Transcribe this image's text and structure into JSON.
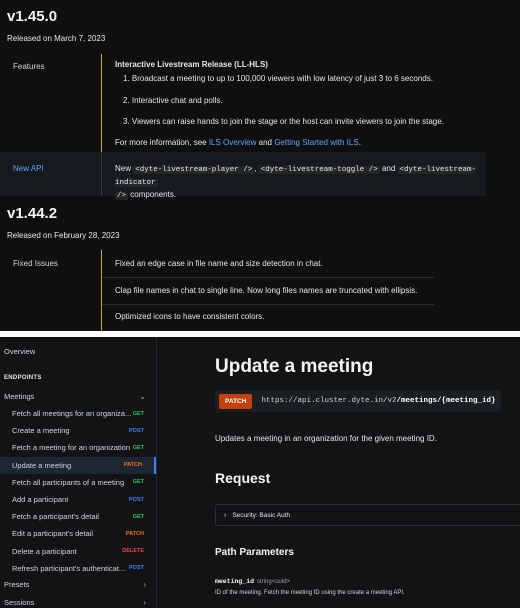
{
  "changelog": {
    "v1": {
      "version": "v1.45.0",
      "released": "Released on March 7, 2023",
      "features_label": "Features",
      "features_title": "Interactive Livestream Release (LL-HLS)",
      "items": [
        "1. Broadcast a meeting to up to 100,000 viewers with low latency of just 3 to 6 seconds.",
        "2. Interactive chat and polls.",
        "3. Viewers can raise hands to join the stage or the host can invite viewers to join the stage."
      ],
      "more_prefix": "For more information, see ",
      "link1": "ILS Overview",
      "and": " and ",
      "link2": "Getting Started with ILS",
      "more_suffix": ".",
      "newapi_label": "New API",
      "newapi_prefix": "New ",
      "code1": "<dyte-livestream-player />",
      "comma": ", ",
      "code2": "<dyte-livestream-toggle />",
      "and2": " and ",
      "code3": "<dyte-livestream-indicator",
      "code3b": "/>",
      "newapi_suffix": " components."
    },
    "v2": {
      "version": "v1.44.2",
      "released": "Released on February 28, 2023",
      "fixed_label": "Fixed Issues",
      "fixes": [
        "Fixed an edge case in file name and size detection in chat.",
        "Clap file names in chat to single line. Now long files names are truncated with ellipsis.",
        "Optimized icons to have consistent colors."
      ]
    }
  },
  "sidebar": {
    "overview": "Overview",
    "endpoints_header": "ENDPOINTS",
    "meetings": "Meetings",
    "items": [
      {
        "label": "Fetch all meetings for an organiza...",
        "method": "GET"
      },
      {
        "label": "Create a meeting",
        "method": "POST"
      },
      {
        "label": "Fetch a meeting for an organization",
        "method": "GET"
      },
      {
        "label": "Update a meeting",
        "method": "PATCH"
      },
      {
        "label": "Fetch all participants of a meeting",
        "method": "GET"
      },
      {
        "label": "Add a participant",
        "method": "POST"
      },
      {
        "label": "Fetch a participant's detail",
        "method": "GET"
      },
      {
        "label": "Edit a participant's detail",
        "method": "PATCH"
      },
      {
        "label": "Delete a participant",
        "method": "DELETE"
      },
      {
        "label": "Refresh participant's authenticat...",
        "method": "POST"
      }
    ],
    "presets": "Presets",
    "sessions": "Sessions"
  },
  "main": {
    "title": "Update a meeting",
    "method": "PATCH",
    "url_base": "https://api.cluster.dyte.in/v2",
    "url_path": "/meetings/{meeting_id}",
    "description": "Updates a meeting in an organization for the given meeting ID.",
    "request_heading": "Request",
    "security": "Security: Basic Auth",
    "path_params_heading": "Path Parameters",
    "param_name": "meeting_id",
    "param_type": "string<uuid>",
    "param_desc": "ID of the meeting. Fetch the meeting ID using the create a meeting API."
  },
  "colors": {
    "accent_bar": "#d4a017",
    "get": "#22c55e",
    "post": "#3b82f6",
    "patch": "#f97316",
    "delete": "#ef4444"
  }
}
